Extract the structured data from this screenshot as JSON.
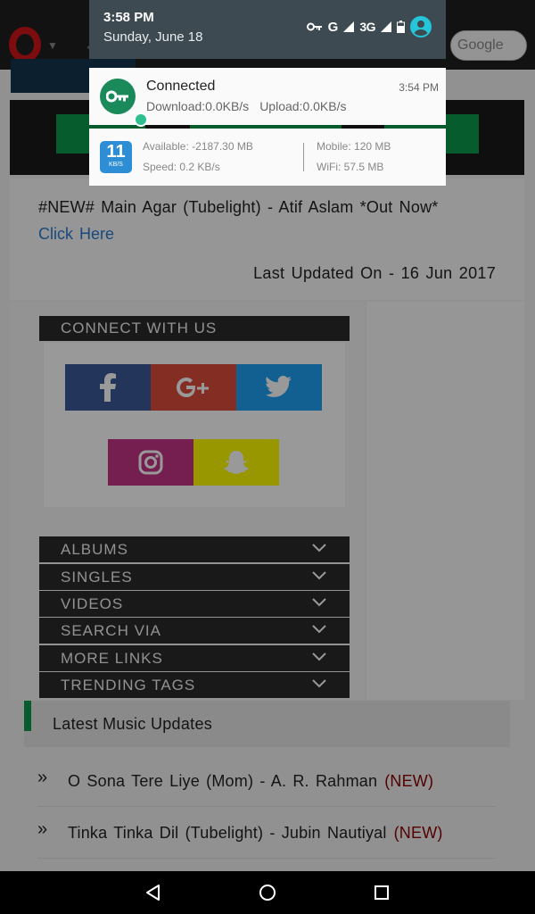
{
  "status_bar": {
    "time": "3:58 PM",
    "date": "Sunday, June 18",
    "network_label_1": "G",
    "network_label_2": "3G"
  },
  "notifications": {
    "vpn": {
      "title": "Connected",
      "time": "3:54 PM",
      "download": "Download:0.0KB/s",
      "upload": "Upload:0.0KB/s"
    },
    "speed": {
      "icon_number": "11",
      "icon_unit": "KB/S",
      "available": "Available: -2187.30 MB",
      "speed": "Speed: 0.2 KB/s",
      "mobile": "Mobile: 120 MB",
      "wifi": "WiFi: 57.5 MB"
    }
  },
  "browser": {
    "search_placeholder": "Google"
  },
  "page": {
    "news": {
      "title": "#NEW# Main Agar (Tubelight) - Atif Aslam *Out Now*",
      "link": "Click Here",
      "updated": "Last Updated On - 16 Jun 2017"
    },
    "connect_title": "CONNECT WITH US",
    "menu": [
      "ALBUMS",
      "SINGLES",
      "VIDEOS",
      "SEARCH VIA",
      "MORE LINKS",
      "TRENDING TAGS"
    ],
    "updates_title": "Latest Music Updates",
    "updates": [
      {
        "text": "O Sona Tere Liye (Mom) - A. R. Rahman",
        "tag": "(NEW)"
      },
      {
        "text": "Tinka Tinka Dil (Tubelight) - Jubin Nautiyal",
        "tag": "(NEW)"
      }
    ]
  },
  "colors": {
    "accent_green": "#0d9a4d",
    "facebook": "#3b5998",
    "google_plus": "#dd4b39",
    "twitter": "#1da1f2",
    "instagram": "#c13584",
    "snapchat": "#fffc00",
    "shade": "#3d4a52"
  }
}
